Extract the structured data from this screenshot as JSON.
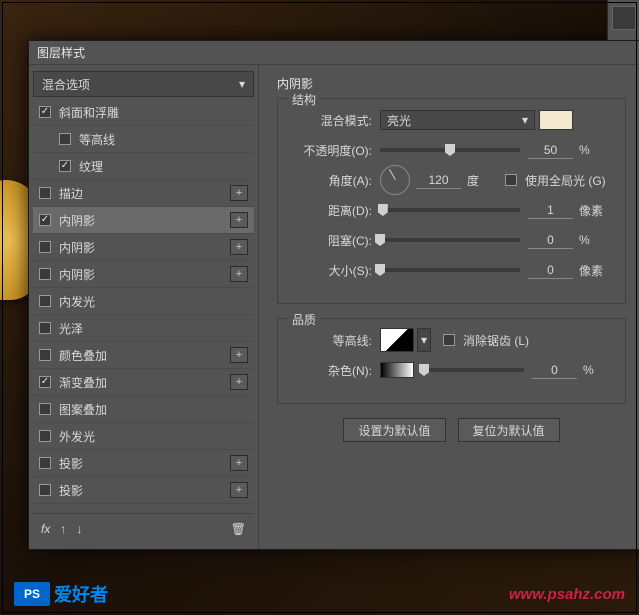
{
  "dialog": {
    "title": "图层样式",
    "blend_options": "混合选项",
    "effects": [
      {
        "label": "斜面和浮雕",
        "checked": true,
        "sub": false,
        "plus": false
      },
      {
        "label": "等高线",
        "checked": false,
        "sub": true,
        "plus": false
      },
      {
        "label": "纹理",
        "checked": true,
        "sub": true,
        "plus": false
      },
      {
        "label": "描边",
        "checked": false,
        "sub": false,
        "plus": true
      },
      {
        "label": "内阴影",
        "checked": true,
        "sub": false,
        "plus": true,
        "selected": true
      },
      {
        "label": "内阴影",
        "checked": false,
        "sub": false,
        "plus": true
      },
      {
        "label": "内阴影",
        "checked": false,
        "sub": false,
        "plus": true
      },
      {
        "label": "内发光",
        "checked": false,
        "sub": false,
        "plus": false
      },
      {
        "label": "光泽",
        "checked": false,
        "sub": false,
        "plus": false
      },
      {
        "label": "颜色叠加",
        "checked": false,
        "sub": false,
        "plus": true
      },
      {
        "label": "渐变叠加",
        "checked": true,
        "sub": false,
        "plus": true
      },
      {
        "label": "图案叠加",
        "checked": false,
        "sub": false,
        "plus": false
      },
      {
        "label": "外发光",
        "checked": false,
        "sub": false,
        "plus": false
      },
      {
        "label": "投影",
        "checked": false,
        "sub": false,
        "plus": true
      },
      {
        "label": "投影",
        "checked": false,
        "sub": false,
        "plus": true
      }
    ],
    "footer_fx": "fx"
  },
  "panel": {
    "heading": "内阴影",
    "group_structure": "结构",
    "group_quality": "品质",
    "blend_mode_label": "混合模式:",
    "blend_mode_value": "亮光",
    "opacity_label": "不透明度(O):",
    "opacity_value": "50",
    "opacity_unit": "%",
    "angle_label": "角度(A):",
    "angle_value": "120",
    "angle_unit": "度",
    "global_light_label": "使用全局光 (G)",
    "distance_label": "距离(D):",
    "distance_value": "1",
    "distance_unit": "像素",
    "choke_label": "阻塞(C):",
    "choke_value": "0",
    "choke_unit": "%",
    "size_label": "大小(S):",
    "size_value": "0",
    "size_unit": "像素",
    "contour_label": "等高线:",
    "antialias_label": "消除锯齿 (L)",
    "noise_label": "杂色(N):",
    "noise_value": "0",
    "noise_unit": "%",
    "btn_default": "设置为默认值",
    "btn_reset": "复位为默认值"
  },
  "watermark": {
    "logo_badge": "PS",
    "logo_text": "爱好者",
    "url": "www.psahz.com"
  }
}
